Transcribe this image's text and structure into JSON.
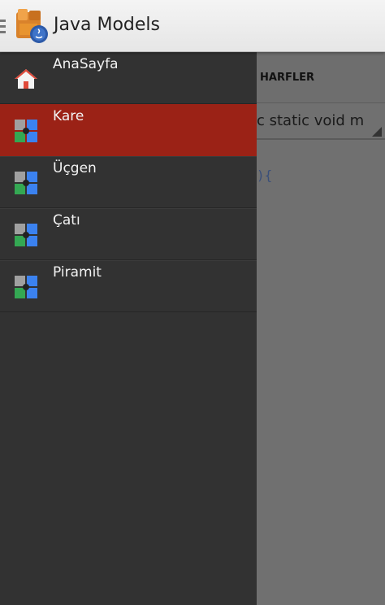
{
  "app": {
    "title": "Java Models"
  },
  "background": {
    "tab_label": "HARFLER",
    "spinner_value": "c static void m",
    "code_snippet": "){"
  },
  "drawer": {
    "items": [
      {
        "label": "AnaSayfa",
        "icon": "home-icon",
        "selected": false
      },
      {
        "label": "Kare",
        "icon": "puzzle-icon",
        "selected": true
      },
      {
        "label": "Üçgen",
        "icon": "puzzle-icon",
        "selected": false
      },
      {
        "label": "Çatı",
        "icon": "puzzle-icon",
        "selected": false
      },
      {
        "label": "Piramit",
        "icon": "puzzle-icon",
        "selected": false
      }
    ]
  },
  "colors": {
    "selected_item": "#9b2216",
    "drawer_bg": "#323232",
    "action_bar": "#eeeeee"
  }
}
